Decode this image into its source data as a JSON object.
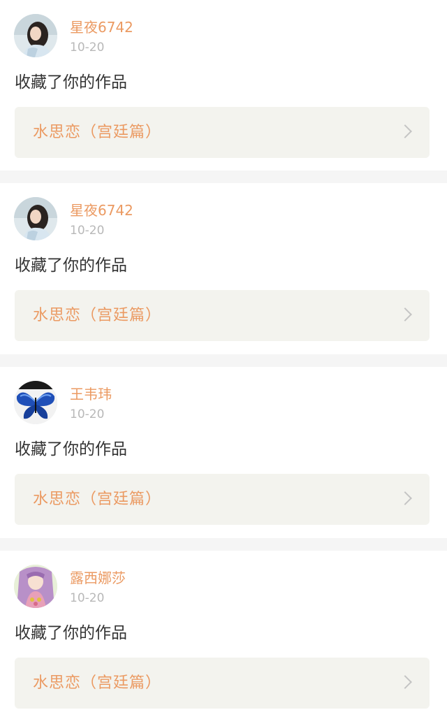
{
  "notifications": [
    {
      "user": "星夜6742",
      "date": "10-20",
      "action": "收藏了你的作品",
      "work_title": "水思恋（宫廷篇）",
      "avatar_icon": "girl-portrait-avatar"
    },
    {
      "user": "星夜6742",
      "date": "10-20",
      "action": "收藏了你的作品",
      "work_title": "水思恋（宫廷篇）",
      "avatar_icon": "girl-portrait-avatar"
    },
    {
      "user": "王韦玮",
      "date": "10-20",
      "action": "收藏了你的作品",
      "work_title": "水思恋（宫廷篇）",
      "avatar_icon": "blue-butterfly-avatar"
    },
    {
      "user": "露西娜莎",
      "date": "10-20",
      "action": "收藏了你的作品",
      "work_title": "水思恋（宫廷篇）",
      "avatar_icon": "anime-princess-avatar"
    }
  ],
  "colors": {
    "accent": "#eb9a62",
    "date_gray": "#b8b8b8",
    "box_bg": "#f3f3ee",
    "page_bg": "#f5f5f5"
  }
}
